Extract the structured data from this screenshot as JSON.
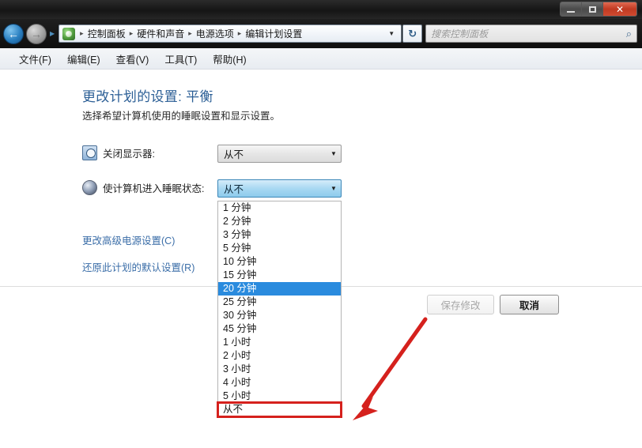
{
  "window": {
    "controls": {
      "minimize": "–",
      "maximize": "□",
      "close": "✕"
    }
  },
  "navbar": {
    "back_icon": "←",
    "forward_icon": "→",
    "breadcrumb_separator": "▸",
    "breadcrumbs": [
      "控制面板",
      "硬件和声音",
      "电源选项",
      "编辑计划设置"
    ],
    "address_dropdown_icon": "▼",
    "refresh_icon": "↻",
    "search_placeholder": "搜索控制面板",
    "search_icon": "⌕"
  },
  "menubar": {
    "items": [
      "文件(F)",
      "编辑(E)",
      "查看(V)",
      "工具(T)",
      "帮助(H)"
    ]
  },
  "main": {
    "title": "更改计划的设置: 平衡",
    "subtitle": "选择希望计算机使用的睡眠设置和显示设置。",
    "settings": [
      {
        "label": "关闭显示器:",
        "value": "从不",
        "arrow": "▼"
      },
      {
        "label": "使计算机进入睡眠状态:",
        "value": "从不",
        "arrow": "▼"
      }
    ],
    "links": [
      "更改高级电源设置(C)",
      "还原此计划的默认设置(R)"
    ]
  },
  "dropdown": {
    "options": [
      "1 分钟",
      "2 分钟",
      "3 分钟",
      "5 分钟",
      "10 分钟",
      "15 分钟",
      "20 分钟",
      "25 分钟",
      "30 分钟",
      "45 分钟",
      "1 小时",
      "2 小时",
      "3 小时",
      "4 小时",
      "5 小时",
      "从不"
    ],
    "selected_index": 6,
    "highlighted_index": 15
  },
  "footer": {
    "save_label": "保存修改",
    "cancel_label": "取消"
  },
  "annotation": {
    "arrow_color": "#d5211d",
    "box_color": "#d5211d"
  },
  "colors": {
    "accent_blue": "#2a8bde",
    "title_blue": "#2c5f96",
    "link_blue": "#3b6ea8",
    "annotation_red": "#d5211d"
  }
}
